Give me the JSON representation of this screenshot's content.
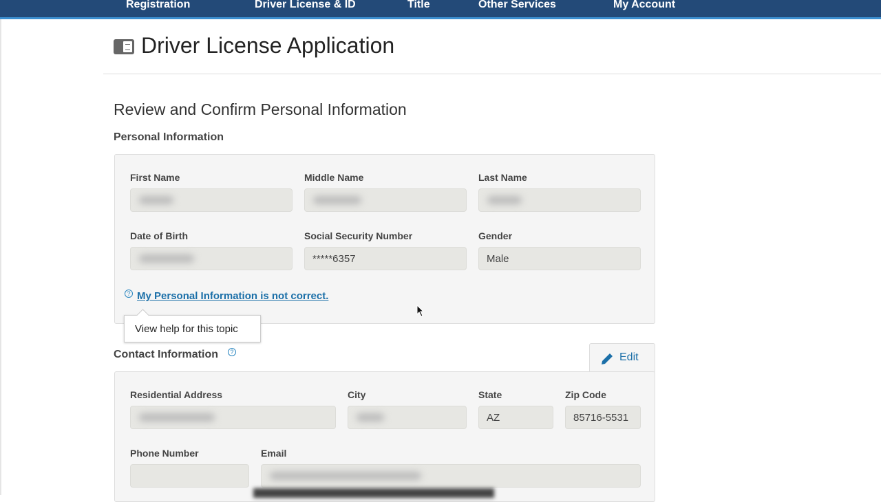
{
  "nav": {
    "items": [
      "Registration",
      "Driver License & ID",
      "Title",
      "Other Services",
      "My Account"
    ]
  },
  "page": {
    "title": "Driver License Application",
    "icon": "license-card-icon"
  },
  "section": {
    "title": "Review and Confirm Personal Information"
  },
  "personal": {
    "heading": "Personal Information",
    "first_name_label": "First Name",
    "middle_name_label": "Middle Name",
    "last_name_label": "Last Name",
    "dob_label": "Date of Birth",
    "ssn_label": "Social Security Number",
    "ssn_value": "*****6357",
    "gender_label": "Gender",
    "gender_value": "Male",
    "incorrect_link": "My Personal Information is not correct.",
    "tooltip": "View help for this topic"
  },
  "contact": {
    "heading": "Contact Information",
    "edit_label": "Edit",
    "address_label": "Residential Address",
    "city_label": "City",
    "state_label": "State",
    "state_value": "AZ",
    "zip_label": "Zip Code",
    "zip_value": "85716-5531",
    "phone_label": "Phone Number",
    "email_label": "Email"
  },
  "colors": {
    "nav": "#234a78",
    "link": "#1b6fa8"
  }
}
